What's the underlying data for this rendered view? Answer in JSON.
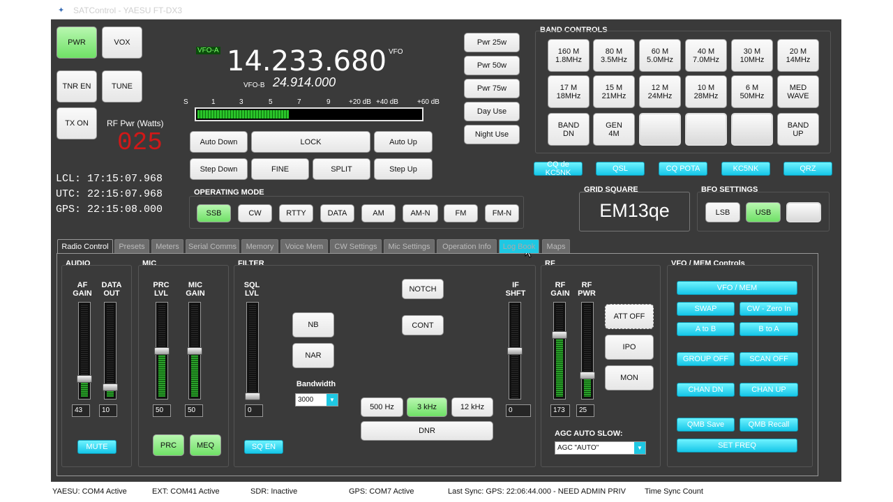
{
  "window": {
    "title": "SATControl - YAESU FT-DX3"
  },
  "top_buttons": {
    "pwr": "PWR",
    "vox": "VOX",
    "tnr_en": "TNR EN",
    "tune": "TUNE",
    "tx_on": "TX ON"
  },
  "rf_power": {
    "label": "RF Pwr (Watts)",
    "value": "025"
  },
  "clocks": {
    "lcl": "LCL: 17:15:07.968",
    "utc": "UTC: 22:15:07.968",
    "gps": "GPS: 22:15:08.000"
  },
  "vfo": {
    "a_label": "VFO-A",
    "a_freq": "14.233.680",
    "mode_label": "VFO",
    "b_label": "VFO-B",
    "b_freq": "24.914.000"
  },
  "meter": {
    "scale": [
      "S",
      "1",
      "3",
      "5",
      "7",
      "9",
      "+20 dB",
      "+40 dB",
      "+60 dB"
    ],
    "level": 0.41
  },
  "vfo_buttons": {
    "auto_down": "Auto Down",
    "lock": "LOCK",
    "auto_up": "Auto Up",
    "step_down": "Step Down",
    "fine": "FINE",
    "split": "SPLIT",
    "step_up": "Step Up"
  },
  "operating_mode": {
    "title": "OPERATING MODE",
    "modes": [
      "SSB",
      "CW",
      "RTTY",
      "DATA",
      "AM",
      "AM-N",
      "FM",
      "FM-N"
    ],
    "active": "SSB"
  },
  "power_presets": [
    "Pwr 25w",
    "Pwr 50w",
    "Pwr 75w",
    "Day Use",
    "Night Use"
  ],
  "band_controls": {
    "title": "BAND CONTROLS",
    "row1": [
      "160 M\n1.8MHz",
      "80 M\n3.5MHz",
      "60 M\n5.0MHz",
      "40 M\n7.0MHz",
      "30 M\n10MHz",
      "20 M\n14MHz"
    ],
    "row2": [
      "17 M\n18MHz",
      "15 M\n21MHz",
      "12 M\n24MHz",
      "10 M\n28MHz",
      "6 M\n50MHz",
      "MED\nWAVE"
    ],
    "band_dn": "BAND\nDN",
    "gen": "GEN\n4M",
    "band_up": "BAND\nUP"
  },
  "macros": [
    "CQ de KC5NK",
    "QSL",
    "CQ POTA",
    "KC5NK",
    "QRZ"
  ],
  "grid_square": {
    "title": "GRID SQUARE",
    "value": "EM13qe"
  },
  "bfo": {
    "title": "BFO SETTINGS",
    "lsb": "LSB",
    "usb": "USB"
  },
  "tabs": [
    "Radio Control",
    "Presets",
    "Meters",
    "Serial Comms",
    "Memory",
    "Voice Mem",
    "CW Settings",
    "Mic Settings",
    "Operation Info",
    "Log Book",
    "Maps"
  ],
  "audio": {
    "title": "AUDIO",
    "af_gain_label": "AF\nGAIN",
    "data_out_label": "DATA\nOUT",
    "af_gain": "43",
    "data_out": "10",
    "mute": "MUTE"
  },
  "mic": {
    "title": "MIC",
    "prc_lvl_label": "PRC\nLVL",
    "mic_gain_label": "MIC\nGAIN",
    "prc_lvl": "50",
    "mic_gain": "50",
    "prc": "PRC",
    "meq": "MEQ"
  },
  "filter": {
    "title": "FILTER",
    "sql_lvl_label": "SQL\nLVL",
    "sql_lvl": "0",
    "nb": "NB",
    "nar": "NAR",
    "notch": "NOTCH",
    "cont": "CONT",
    "if_shft_label": "IF\nSHFT",
    "if_shft": "0",
    "bandwidth_label": "Bandwidth",
    "bandwidth": "3000",
    "bw500": "500 Hz",
    "bw3k": "3 kHz",
    "bw12k": "12 kHz",
    "dnr": "DNR",
    "sq_en": "SQ EN"
  },
  "rf": {
    "title": "RF",
    "rf_gain_label": "RF\nGAIN",
    "rf_pwr_label": "RF\nPWR",
    "rf_gain": "173",
    "rf_pwr": "25",
    "att": "ATT OFF",
    "ipo": "IPO",
    "mon": "MON",
    "agc_label": "AGC AUTO SLOW:",
    "agc": "AGC \"AUTO\""
  },
  "vfo_mem": {
    "title": "VFO / MEM Controls",
    "vfo_mem": "VFO / MEM",
    "swap": "SWAP",
    "cw_zero": "CW - Zero In",
    "a_to_b": "A to B",
    "b_to_a": "B to A",
    "group_off": "GROUP OFF",
    "scan_off": "SCAN OFF",
    "chan_dn": "CHAN DN",
    "chan_up": "CHAN UP",
    "qmb_save": "QMB Save",
    "qmb_recall": "QMB Recall",
    "set_freq": "SET FREQ"
  },
  "status_bar": {
    "yaesu": "YAESU: COM4 Active",
    "ext": "EXT: COM41 Active",
    "sdr": "SDR: Inactive",
    "gps": "GPS: COM7 Active",
    "last_sync": "Last Sync:  GPS: 22:06:44.000 - NEED ADMIN PRIV",
    "time_sync": "Time Sync Count"
  },
  "colors": {
    "panel": "#3a3a3a",
    "accent_cyan": "#1ec8e3",
    "green_on": "#6fe066",
    "rf_red": "#d01818"
  }
}
